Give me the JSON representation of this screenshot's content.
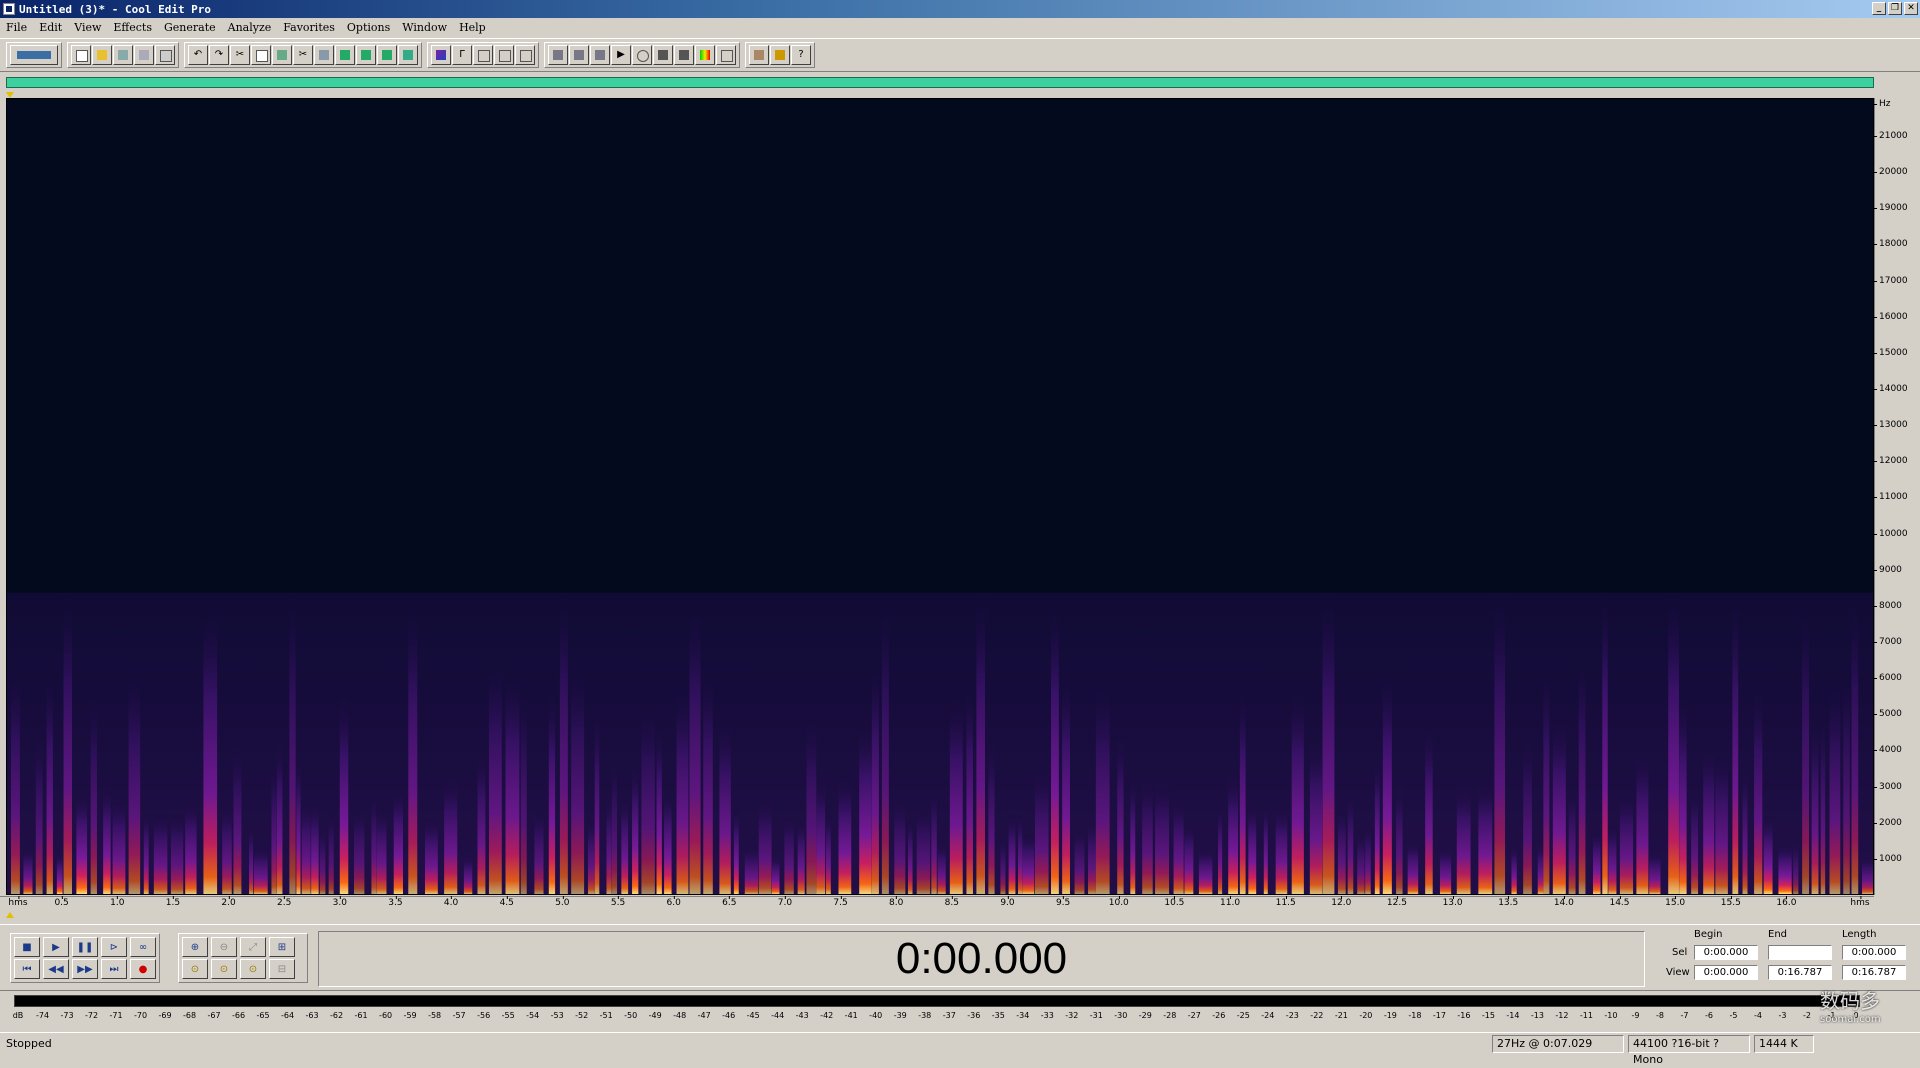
{
  "window": {
    "title": "Untitled (3)* - Cool Edit Pro",
    "buttons": [
      "_",
      "❐",
      "✕"
    ]
  },
  "menu": [
    "File",
    "Edit",
    "View",
    "Effects",
    "Generate",
    "Analyze",
    "Favorites",
    "Options",
    "Window",
    "Help"
  ],
  "spectrogram": {
    "frequency_unit": "Hz",
    "frequency_labels": [
      "21000",
      "20000",
      "19000",
      "18000",
      "17000",
      "16000",
      "15000",
      "14000",
      "13000",
      "12000",
      "11000",
      "10000",
      "9000",
      "8000",
      "7000",
      "6000",
      "5000",
      "4000",
      "3000",
      "2000",
      "1000"
    ],
    "time_start_label": "hms",
    "time_end_label": "hms",
    "time_labels": [
      "0.5",
      "1.0",
      "1.5",
      "2.0",
      "2.5",
      "3.0",
      "3.5",
      "4.0",
      "4.5",
      "5.0",
      "5.5",
      "6.0",
      "6.5",
      "7.0",
      "7.5",
      "8.0",
      "8.5",
      "9.0",
      "9.5",
      "10.0",
      "10.5",
      "11.0",
      "11.5",
      "12.0",
      "12.5",
      "13.0",
      "13.5",
      "14.0",
      "14.5",
      "15.0",
      "15.5",
      "16.0"
    ],
    "colors": {
      "background": "#040a1e",
      "low": "#5a1a8a",
      "mid": "#c0206a",
      "high": "#ff6a10",
      "peak": "#ffe080"
    }
  },
  "time_display": "0:00.000",
  "selection": {
    "headers": {
      "begin": "Begin",
      "end": "End",
      "length": "Length"
    },
    "sel_label": "Sel",
    "view_label": "View",
    "sel_begin": "0:00.000",
    "sel_end": "",
    "sel_length": "0:00.000",
    "view_begin": "0:00.000",
    "view_end": "0:16.787",
    "view_length": "0:16.787"
  },
  "level_meter": {
    "labels": [
      "dB",
      "-74",
      "-73",
      "-72",
      "-71",
      "-70",
      "-69",
      "-68",
      "-67",
      "-66",
      "-65",
      "-64",
      "-63",
      "-62",
      "-61",
      "-60",
      "-59",
      "-58",
      "-57",
      "-56",
      "-55",
      "-54",
      "-53",
      "-52",
      "-51",
      "-50",
      "-49",
      "-48",
      "-47",
      "-46",
      "-45",
      "-44",
      "-43",
      "-42",
      "-41",
      "-40",
      "-39",
      "-38",
      "-37",
      "-36",
      "-35",
      "-34",
      "-33",
      "-32",
      "-31",
      "-30",
      "-29",
      "-28",
      "-27",
      "-26",
      "-25",
      "-24",
      "-23",
      "-22",
      "-21",
      "-20",
      "-19",
      "-18",
      "-17",
      "-16",
      "-15",
      "-14",
      "-13",
      "-12",
      "-11",
      "-10",
      "-9",
      "-8",
      "-7",
      "-6",
      "-5",
      "-4",
      "-3",
      "-2",
      "-1",
      "0"
    ]
  },
  "status": {
    "state": "Stopped",
    "cursor": "27Hz @  0:07.029",
    "format": "44100 ?16-bit ?Mono",
    "size": "1444 K"
  },
  "watermark": {
    "text": "数码多",
    "sub": "soomal.com"
  }
}
